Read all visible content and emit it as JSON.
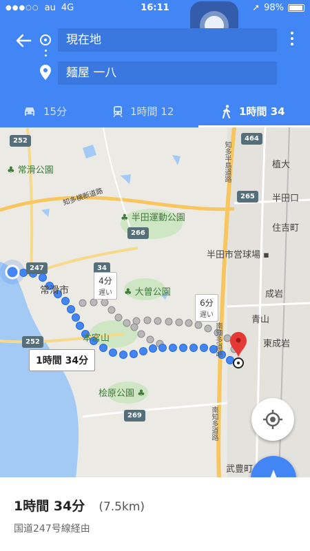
{
  "status": {
    "carrier": "au",
    "network": "4G",
    "time": "16:11",
    "battery": "98%"
  },
  "header": {
    "from": "現在地",
    "to": "麺屋 一八"
  },
  "tabs": [
    {
      "icon": "car-icon",
      "label": "15分"
    },
    {
      "icon": "train-icon",
      "label": "1時間 12"
    },
    {
      "icon": "walk-icon",
      "label": "1時間 34",
      "active": true
    }
  ],
  "map": {
    "labels": {
      "park1": "常滑公園",
      "park2": "半田運動公園",
      "park3": "大曽公園",
      "park4": "桧原公園",
      "city": "常滑市",
      "motomiya": "本宮山",
      "stadium": "半田市営球場",
      "uetoi": "植大",
      "handaguchi": "半田口",
      "sumiyoshi": "住吉町",
      "narawa": "成岩",
      "aoyama": "青山",
      "higashinarawa": "東成岩",
      "taketoyo": "武豊町",
      "road1": "知多横断道路",
      "road2": "知多半島道路",
      "road3": "南知多道路",
      "road4": "南知多道路"
    },
    "shields": [
      "252",
      "247",
      "34",
      "266",
      "265",
      "464",
      "252",
      "269"
    ],
    "callouts": [
      {
        "time": "4分",
        "note": "遅い"
      },
      {
        "time": "6分",
        "note": "遅い"
      }
    ],
    "main_route_label": "1時間 34分"
  },
  "summary": {
    "duration": "1時間 34分",
    "distance": "(7.5km)",
    "via": "国道247号線経由"
  },
  "colors": {
    "primary": "#4285f4",
    "route": "#4285f4",
    "alt_route": "#aaaaaa",
    "pin": "#e53935"
  }
}
